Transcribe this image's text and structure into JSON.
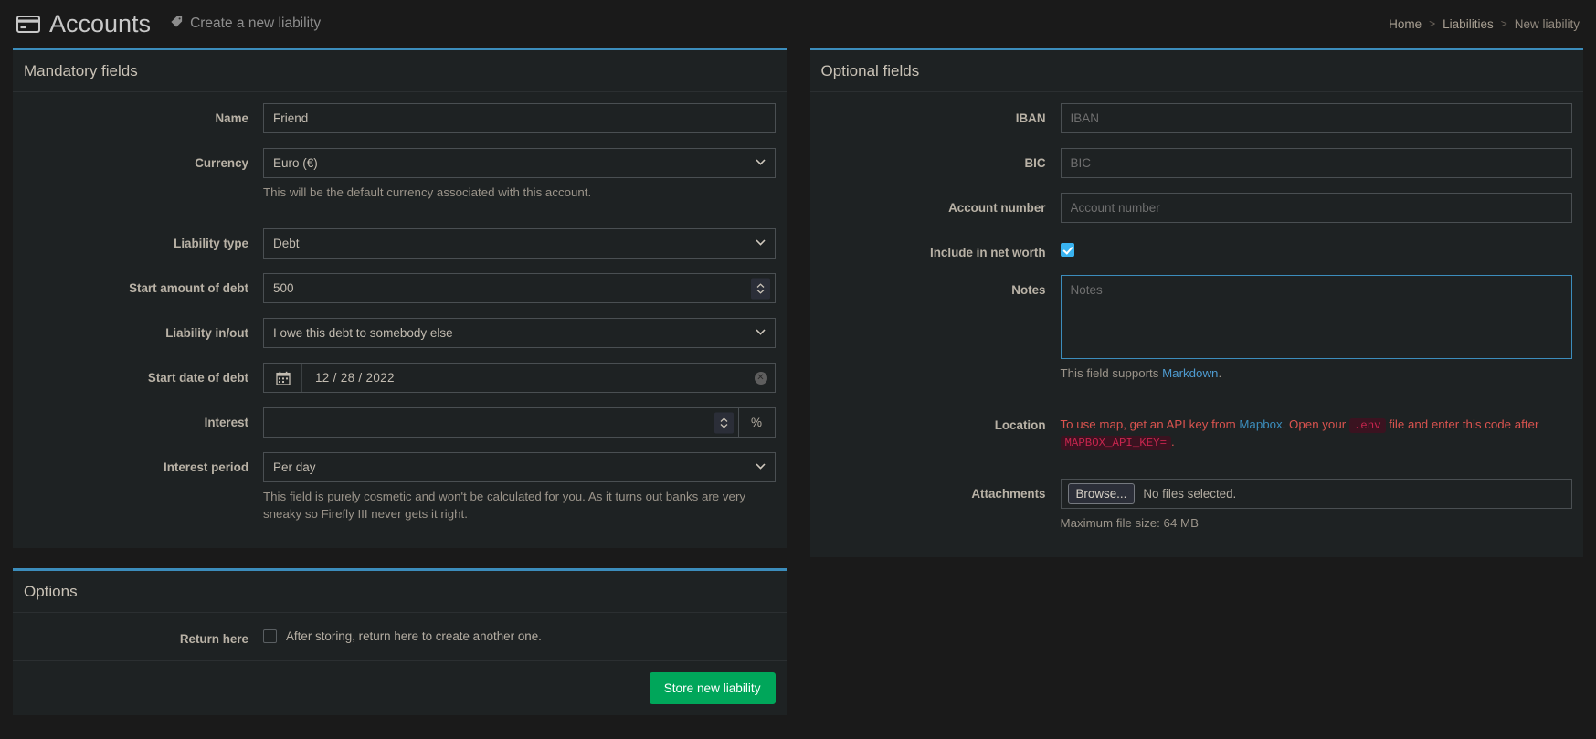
{
  "header": {
    "title": "Accounts",
    "title_icon": "credit-card-icon",
    "subtitle": "Create a new liability",
    "subtitle_icon": "tag-icon"
  },
  "breadcrumb": {
    "home": "Home",
    "sep1": ">",
    "liabilities": "Liabilities",
    "sep2": ">",
    "current": "New liability"
  },
  "mandatory": {
    "title": "Mandatory fields",
    "name": {
      "label": "Name",
      "value": "Friend"
    },
    "currency": {
      "label": "Currency",
      "value": "Euro (€)",
      "help": "This will be the default currency associated with this account."
    },
    "liability_type": {
      "label": "Liability type",
      "value": "Debt"
    },
    "start_amount": {
      "label": "Start amount of debt",
      "value": "500"
    },
    "liability_inout": {
      "label": "Liability in/out",
      "value": "I owe this debt to somebody else"
    },
    "start_date": {
      "label": "Start date of debt",
      "value": "12 / 28 / 2022",
      "icon": "calendar-icon",
      "clear_icon": "clear-circle-icon"
    },
    "interest": {
      "label": "Interest",
      "value": "",
      "addon": "%"
    },
    "interest_period": {
      "label": "Interest period",
      "value": "Per day",
      "help": "This field is purely cosmetic and won't be calculated for you. As it turns out banks are very sneaky so Firefly III never gets it right."
    }
  },
  "options": {
    "title": "Options",
    "return_here": {
      "label": "Return here",
      "checkbox_text": "After storing, return here to create another one.",
      "checked": false
    },
    "submit_label": "Store new liability"
  },
  "optional": {
    "title": "Optional fields",
    "iban": {
      "label": "IBAN",
      "placeholder": "IBAN",
      "value": ""
    },
    "bic": {
      "label": "BIC",
      "placeholder": "BIC",
      "value": ""
    },
    "account_number": {
      "label": "Account number",
      "placeholder": "Account number",
      "value": ""
    },
    "include_net_worth": {
      "label": "Include in net worth",
      "checked": true
    },
    "notes": {
      "label": "Notes",
      "placeholder": "Notes",
      "value": "",
      "help_prefix": "This field supports ",
      "help_link": "Markdown",
      "help_suffix": "."
    },
    "location": {
      "label": "Location",
      "text_1": "To use map, get an API key from ",
      "link": "Mapbox",
      "text_2": ". Open your ",
      "code_1": ".env",
      "text_3": " file and enter this code after ",
      "code_2": "MAPBOX_API_KEY=",
      "text_4": "."
    },
    "attachments": {
      "label": "Attachments",
      "browse_label": "Browse...",
      "status": "No files selected.",
      "help": "Maximum file size: 64 MB"
    }
  },
  "colors": {
    "accent": "#3c8dbc",
    "success": "#00a65a",
    "danger": "#d9534f",
    "checkbox": "#39b3f0",
    "page_bg": "#1a1a1a",
    "box_bg": "#1e2223"
  }
}
